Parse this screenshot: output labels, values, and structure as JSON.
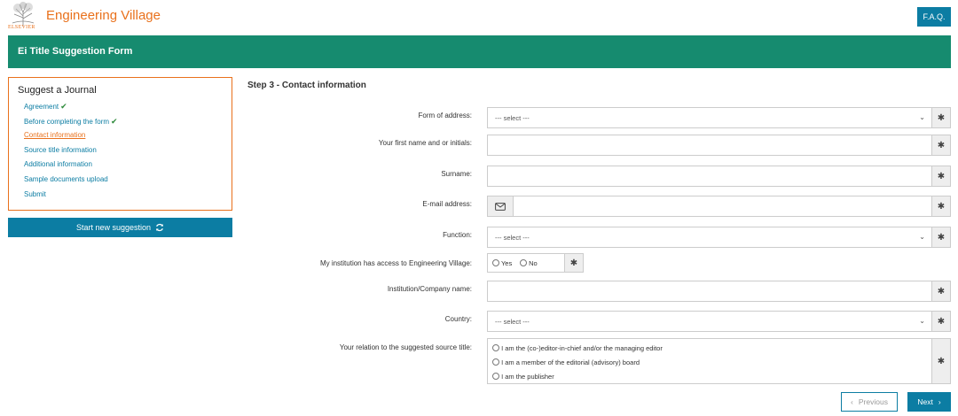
{
  "header": {
    "logo_text": "ELSEVIER",
    "brand": "Engineering Village",
    "faq_label": "F.A.Q."
  },
  "titlebar": {
    "title": "Ei Title Suggestion Form"
  },
  "sidebar": {
    "heading": "Suggest a Journal",
    "items": [
      {
        "label": "Agreement",
        "done": true
      },
      {
        "label": "Before completing the form",
        "done": true
      },
      {
        "label": "Contact information",
        "active": true
      },
      {
        "label": "Source title information"
      },
      {
        "label": "Additional information"
      },
      {
        "label": "Sample documents upload"
      },
      {
        "label": "Submit"
      }
    ],
    "new_button": "Start new suggestion"
  },
  "main": {
    "step_title": "Step 3 - Contact information",
    "fields": {
      "form_of_address": {
        "label": "Form of address:",
        "value": "--- select ---"
      },
      "first_name": {
        "label": "Your first name and or initials:",
        "value": ""
      },
      "surname": {
        "label": "Surname:",
        "value": ""
      },
      "email": {
        "label": "E-mail address:",
        "value": ""
      },
      "function": {
        "label": "Function:",
        "value": "--- select ---"
      },
      "institution_access": {
        "label": "My institution has access to Engineering Village:",
        "yes": "Yes",
        "no": "No"
      },
      "institution_name": {
        "label": "Institution/Company name:",
        "value": ""
      },
      "country": {
        "label": "Country:",
        "value": "--- select ---"
      },
      "relation": {
        "label": "Your relation to the suggested source title:",
        "options": [
          "I am the (co-)editor-in-chief and/or the managing editor",
          "I am a member of the editorial (advisory) board",
          "I am the publisher"
        ]
      }
    },
    "required_mark": "✱",
    "prev_label": "Previous",
    "next_label": "Next"
  },
  "colors": {
    "brand_orange": "#e9711c",
    "primary_blue": "#0c7da3",
    "header_green": "#168b6f"
  }
}
